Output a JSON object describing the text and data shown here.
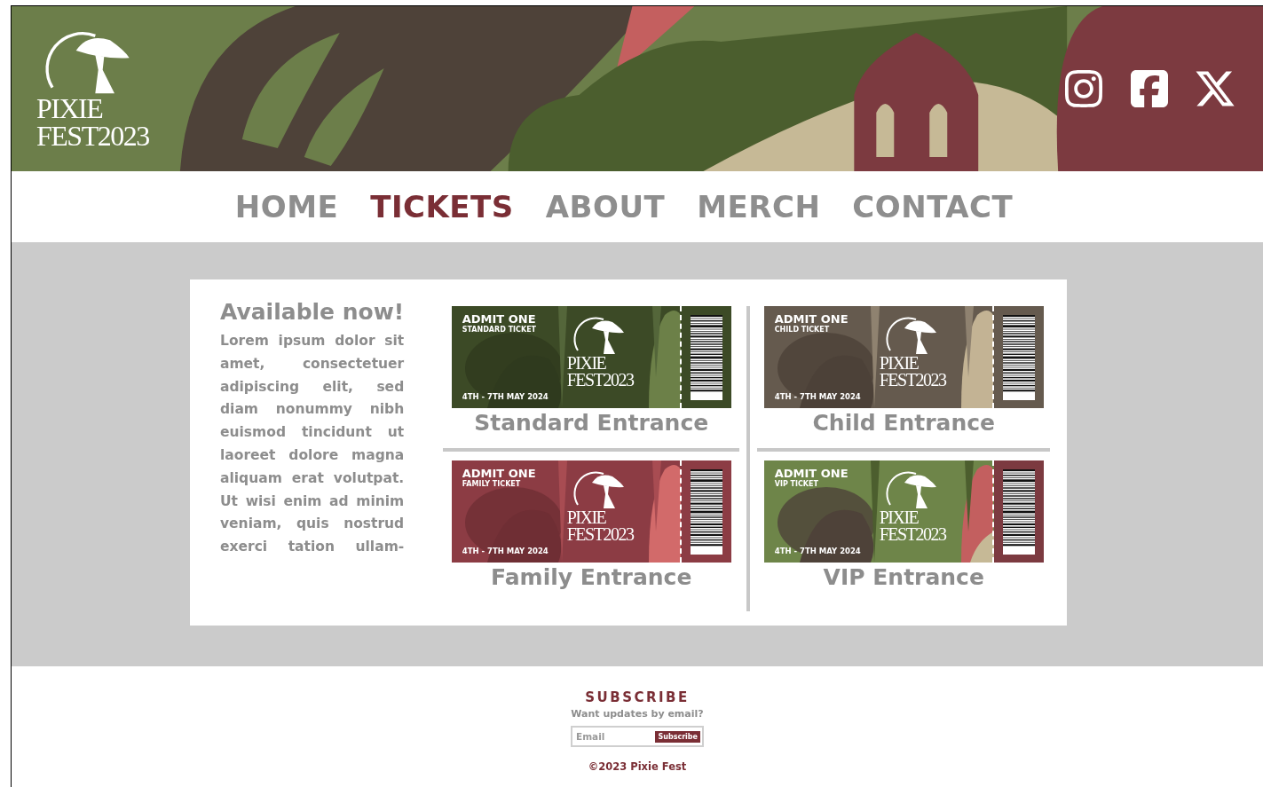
{
  "header": {
    "logo": {
      "line_1": "PIXIE",
      "line_2": "FEST2023"
    },
    "social_links": [
      {
        "kind": "instagram"
      },
      {
        "kind": "facebook"
      },
      {
        "kind": "x"
      }
    ]
  },
  "nav": [
    {
      "label": "HOME",
      "selected": false
    },
    {
      "label": "TICKETS",
      "selected": true
    },
    {
      "label": "ABOUT",
      "selected": false
    },
    {
      "label": "MERCH",
      "selected": false
    },
    {
      "label": "CONTACT",
      "selected": false
    }
  ],
  "intro": {
    "heading": "Available now!",
    "text": "Lorem ipsum dolor sit amet, consectetuer adipiscing elit, sed diam nonummy nibh euismod tincidunt ut laoreet dolore magna aliquam erat volutpat. Ut wisi enim ad minim veniam, quis nostrud exerci tation ullam-"
  },
  "tickets": [
    {
      "kind": "standard",
      "admit": "ADMIT ONE",
      "type": "STANDARD TICKET",
      "dates": "4TH - 7TH MAY 2024",
      "logo_line_1": "PIXIE",
      "logo_line_2": "FEST2023",
      "caption": "Standard Entrance"
    },
    {
      "kind": "child",
      "admit": "ADMIT ONE",
      "type": "CHILD TICKET",
      "dates": "4TH - 7TH MAY 2024",
      "logo_line_1": "PIXIE",
      "logo_line_2": "FEST2023",
      "caption": "Child Entrance"
    },
    {
      "kind": "family",
      "admit": "ADMIT ONE",
      "type": "FAMILY TICKET",
      "dates": "4TH - 7TH MAY 2024",
      "logo_line_1": "PIXIE",
      "logo_line_2": "FEST2023",
      "caption": "Family Entrance"
    },
    {
      "kind": "vip",
      "admit": "ADMIT ONE",
      "type": "VIP TICKET",
      "dates": "4TH - 7TH MAY 2024",
      "logo_line_1": "PIXIE",
      "logo_line_2": "FEST2023",
      "caption": "VIP Entrance"
    }
  ],
  "subscribe": {
    "title": "SUBSCRIBE",
    "subtitle": "Want updates by email?",
    "placeholder": "Email",
    "button": "Subscribe"
  },
  "copyright": "©2023 Pixie Fest"
}
